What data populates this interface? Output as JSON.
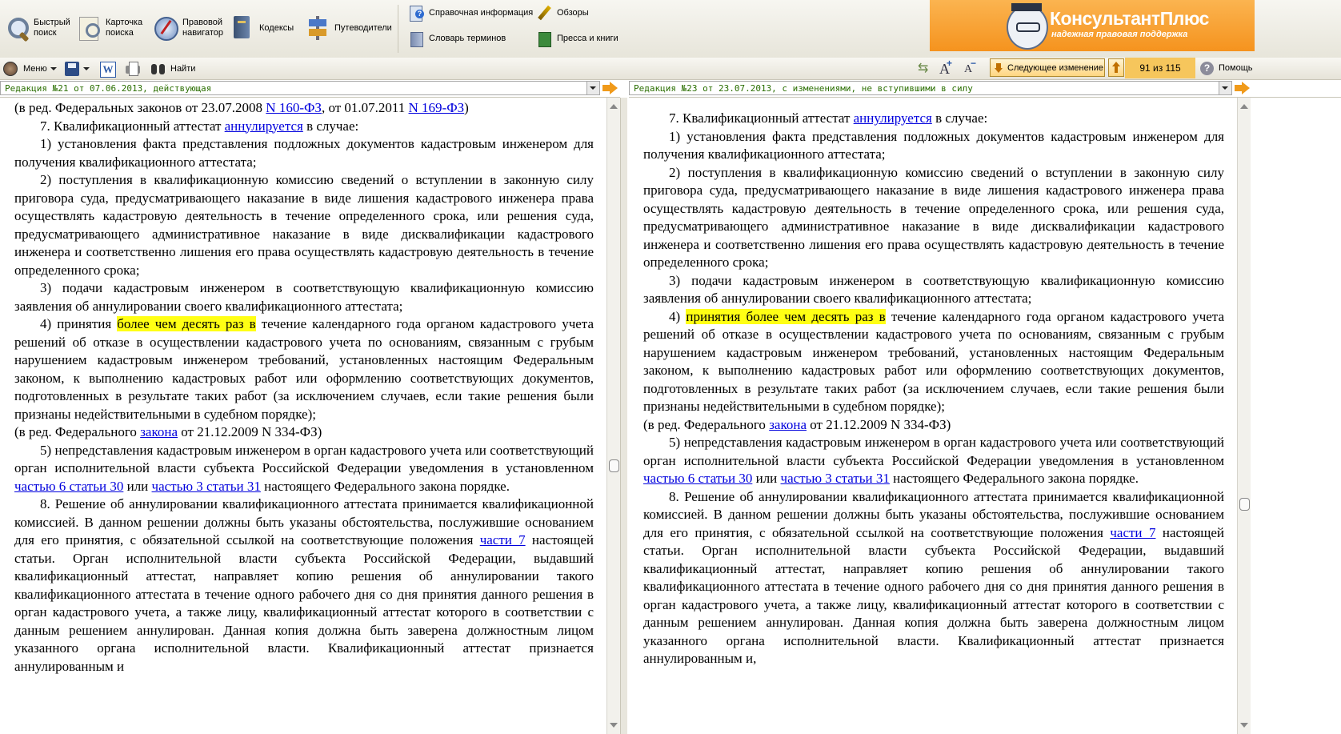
{
  "toolbar": {
    "quick_search": "Быстрый\nпоиск",
    "card_search": "Карточка\nпоиска",
    "legal_navigator": "Правовой\nнавигатор",
    "codes": "Кодексы",
    "guides": "Путеводители",
    "reference_info": "Справочная информация",
    "reviews": "Обзоры",
    "glossary": "Словарь терминов",
    "press_books": "Пресса и книги"
  },
  "brand": {
    "name": "КонсультантПлюс",
    "tagline": "надежная правовая поддержка"
  },
  "toolbar2": {
    "menu": "Меню",
    "find": "Найти",
    "next_change": "Следующее изменение",
    "counter": "91 из 115",
    "help": "Помощь"
  },
  "left": {
    "edition": "Редакция №21 от 07.06.2013, действующая",
    "top_line": "(в ред. Федеральных законов от 23.07.2008 ",
    "top_link1": "N 160-ФЗ",
    "top_mid": ", от 01.07.2011 ",
    "top_link2": "N 169-ФЗ",
    "top_end": ")",
    "p7_pre": "7. Квалификационный аттестат ",
    "p7_link": "аннулируется",
    "p7_post": " в случае:",
    "item1": "1) установления факта представления подложных документов кадастровым инженером для получения квалификационного аттестата;",
    "item2": "2) поступления в квалификационную комиссию сведений о вступлении в законную силу приговора суда, предусматривающего наказание в виде лишения кадастрового инженера права осуществлять кадастровую деятельность в течение определенного срока, или решения суда, предусматривающего административное наказание в виде дисквалификации кадастрового инженера и соответственно лишения его права осуществлять кадастровую деятельность в течение определенного срока;",
    "item3": "3) подачи кадастровым инженером в соответствующую квалификационную комиссию заявления об аннулировании своего квалификационного аттестата;",
    "item4_pre": "4) принятия ",
    "item4_hl": "более чем десять раз в",
    "item4_post": " течение календарного года органом кадастрового учета решений об отказе в осуществлении кадастрового учета по основаниям, связанным с грубым нарушением кадастровым инженером требований, установленных настоящим Федеральным законом, к выполнению кадастровых работ или оформлению соответствующих документов, подготовленных в результате таких работ (за исключением случаев, если такие решения были признаны недействительными в судебном порядке);",
    "amend_pre": "(в ред. Федерального ",
    "amend_link": "закона",
    "amend_post": " от 21.12.2009 N 334-ФЗ)",
    "item5_pre": "5) непредставления кадастровым инженером в орган кадастрового учета или соответствующий орган исполнительной власти субъекта Российской Федерации уведомления в установленном ",
    "item5_link1": "частью 6 статьи 30",
    "item5_mid": " или ",
    "item5_link2": "частью 3 статьи 31",
    "item5_post": " настоящего Федерального закона порядке.",
    "p8_pre": "8. Решение об аннулировании квалификационного аттестата принимается квалификационной комиссией. В данном решении должны быть указаны обстоятельства, послужившие основанием для его принятия, с обязательной ссылкой на соответствующие положения ",
    "p8_link": "части 7",
    "p8_post": " настоящей статьи. Орган исполнительной власти субъекта Российской Федерации, выдавший квалификационный аттестат, направляет копию решения об аннулировании такого квалификационного аттестата в течение одного рабочего дня со дня принятия данного решения в орган кадастрового учета, а также лицу, квалификационный аттестат которого в соответствии с данным решением аннулирован. Данная копия должна быть заверена должностным лицом указанного органа исполнительной власти. Квалификационный аттестат признается аннулированным и"
  },
  "right": {
    "edition": "Редакция №23 от 23.07.2013, с изменениями, не вступившими в силу",
    "p7_pre": "7. Квалификационный аттестат ",
    "p7_link": "аннулируется",
    "p7_post": " в случае:",
    "item1": "1) установления факта представления подложных документов кадастровым инженером для получения квалификационного аттестата;",
    "item2": "2) поступления в квалификационную комиссию сведений о вступлении в законную силу приговора суда, предусматривающего наказание в виде лишения кадастрового инженера права осуществлять кадастровую деятельность в течение определенного срока, или решения суда, предусматривающего административное наказание в виде дисквалификации кадастрового инженера и соответственно лишения его права осуществлять кадастровую деятельность в течение определенного срока;",
    "item3": "3) подачи кадастровым инженером в соответствующую квалификационную комиссию заявления об аннулировании своего квалификационного аттестата;",
    "item4_pre": "4) ",
    "item4_hl": "принятия более чем десять раз в",
    "item4_post": " течение календарного года органом кадастрового учета решений об отказе в осуществлении кадастрового учета по основаниям, связанным с грубым нарушением кадастровым инженером требований, установленных настоящим Федеральным законом, к выполнению кадастровых работ или оформлению соответствующих документов, подготовленных в результате таких работ (за исключением случаев, если такие решения были признаны недействительными в судебном порядке);",
    "amend_pre": "(в ред. Федерального ",
    "amend_link": "закона",
    "amend_post": " от 21.12.2009 N 334-ФЗ)",
    "item5_pre": "5) непредставления кадастровым инженером в орган кадастрового учета или соответствующий орган исполнительной власти субъекта Российской Федерации уведомления в установленном ",
    "item5_link1": "частью 6 статьи 30",
    "item5_mid": " или ",
    "item5_link2": "частью 3 статьи 31",
    "item5_post": " настоящего Федерального закона порядке.",
    "p8_pre": "8. Решение об аннулировании квалификационного аттестата принимается квалификационной комиссией. В данном решении должны быть указаны обстоятельства, послужившие основанием для его принятия, с обязательной ссылкой на соответствующие положения ",
    "p8_link": "части 7",
    "p8_post": " настоящей статьи. Орган исполнительной власти субъекта Российской Федерации, выдавший квалификационный аттестат, направляет копию решения об аннулировании такого квалификационного аттестата в течение одного рабочего дня со дня принятия данного решения в орган кадастрового учета, а также лицу, квалификационный аттестат которого в соответствии с данным решением аннулирован. Данная копия должна быть заверена должностным лицом указанного органа исполнительной власти. Квалификационный аттестат признается аннулированным и,"
  },
  "colors": {
    "highlight": "#ffff14",
    "link": "#0000dd",
    "edition_text": "#2a6e00",
    "brand": "#f5931e"
  }
}
